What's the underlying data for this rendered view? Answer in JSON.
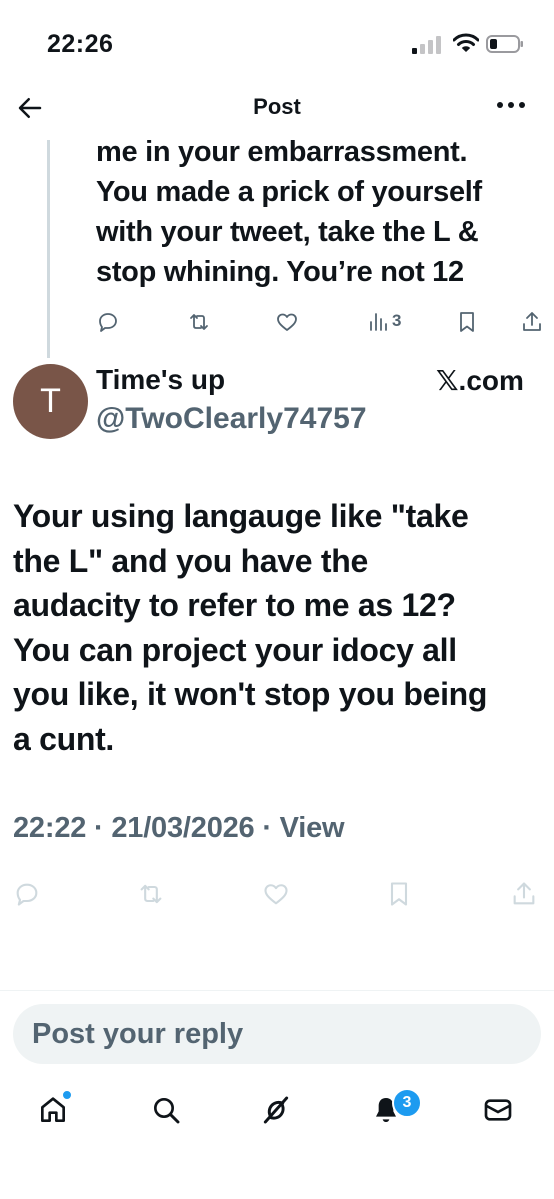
{
  "status_bar": {
    "time": "22:26"
  },
  "header": {
    "title": "Post"
  },
  "previous_tweet": {
    "text_lines": [
      "me in your embarrassment.",
      "You made a prick of yourself",
      "with your tweet, take the L &",
      "stop whining. You’re not 12"
    ],
    "views_count": "3",
    "icons": [
      "reply-icon",
      "retweet-icon",
      "like-icon",
      "views-icon",
      "bookmark-icon",
      "share-icon"
    ]
  },
  "tweet": {
    "avatar_letter": "T",
    "avatar_color": "#795548",
    "display_name": "Time's up",
    "handle": "@TwoClearly74757",
    "source": "𝕏.com",
    "text_lines": [
      "Your using langauge like \"take",
      "the L\" and you have the",
      "audacity to refer to me as 12?",
      "You can project your idocy all",
      "you like, it won't stop you being",
      "a cunt."
    ],
    "timestamp": "22:22 · 21/03/2026 · View",
    "icons": [
      "reply-icon",
      "retweet-icon",
      "like-icon",
      "bookmark-icon",
      "share-icon"
    ]
  },
  "reply": {
    "placeholder": "Post your reply"
  },
  "bottom_nav": {
    "items": [
      "home-icon",
      "search-icon",
      "grok-icon",
      "notifications-icon",
      "messages-icon"
    ],
    "notifications_badge": "3"
  },
  "colors": {
    "accent": "#1d9bf0",
    "text": "#0f1419",
    "secondary": "#536471",
    "disabled": "#cfd9de"
  }
}
